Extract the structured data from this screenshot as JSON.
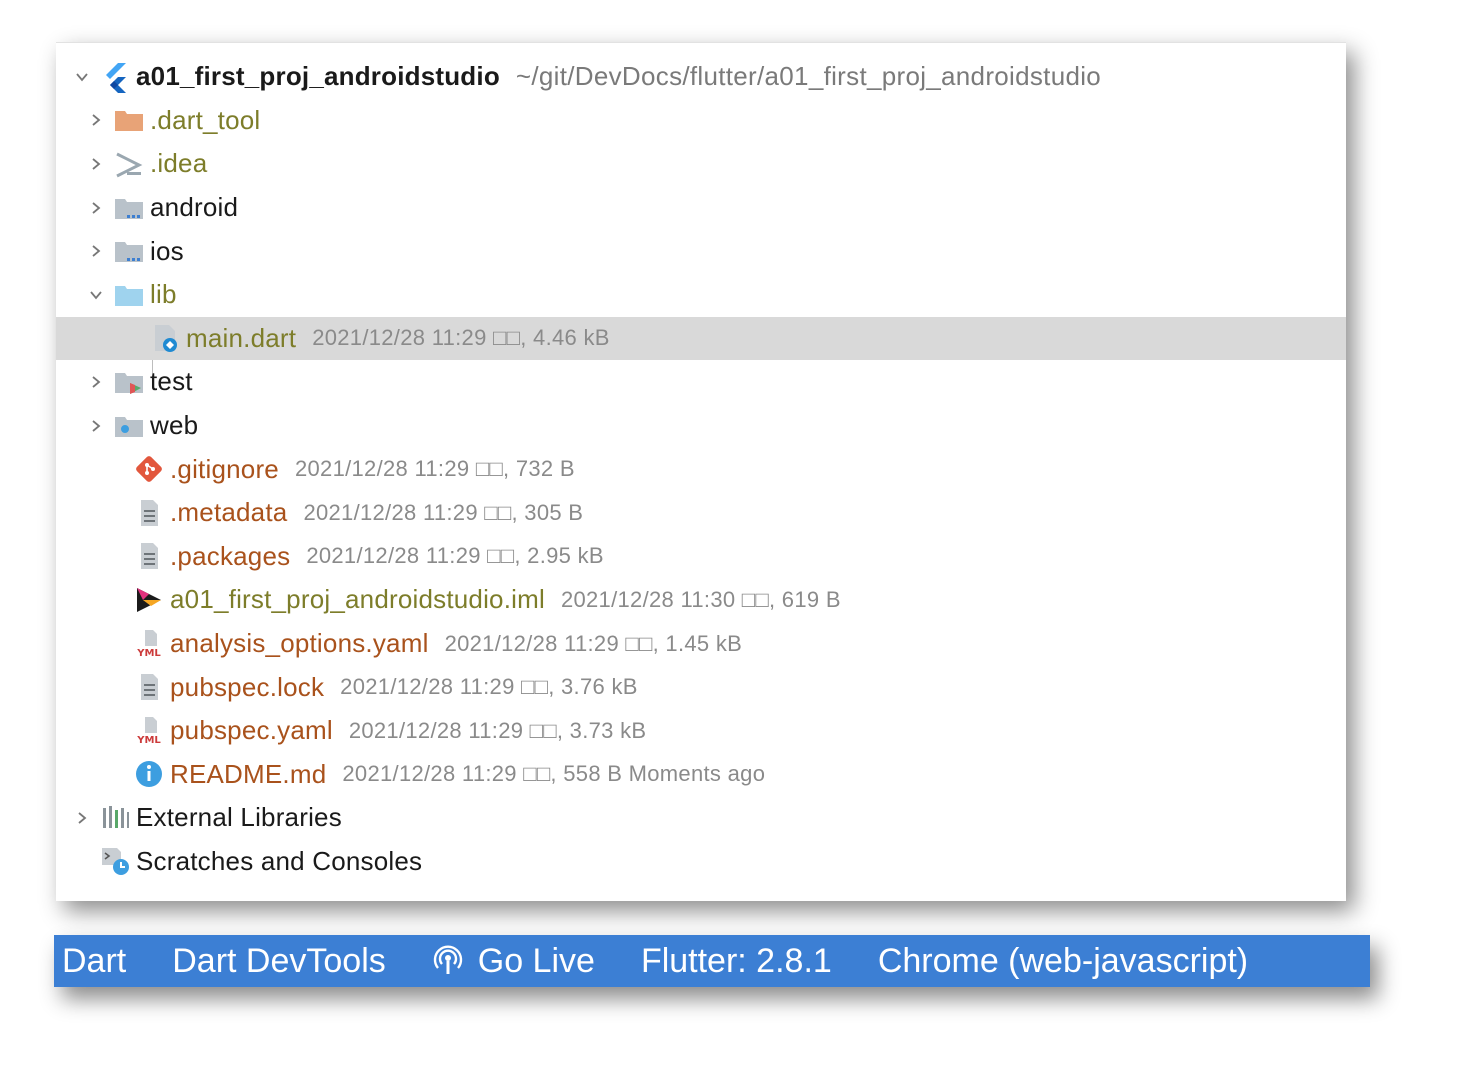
{
  "project": {
    "name": "a01_first_proj_androidstudio",
    "path": "~/git/DevDocs/flutter/a01_first_proj_androidstudio"
  },
  "tree": {
    "dart_tool": ".dart_tool",
    "idea": ".idea",
    "android": "android",
    "ios": "ios",
    "lib": "lib",
    "main_dart": {
      "name": "main.dart",
      "meta": "2021/12/28 11:29 □□, 4.46 kB"
    },
    "test": "test",
    "web": "web",
    "gitignore": {
      "name": ".gitignore",
      "meta": "2021/12/28 11:29 □□, 732 B"
    },
    "metadata": {
      "name": ".metadata",
      "meta": "2021/12/28 11:29 □□, 305 B"
    },
    "packages": {
      "name": ".packages",
      "meta": "2021/12/28 11:29 □□, 2.95 kB"
    },
    "iml": {
      "name": "a01_first_proj_androidstudio.iml",
      "meta": "2021/12/28 11:30 □□, 619 B"
    },
    "analysis": {
      "name": "analysis_options.yaml",
      "meta": "2021/12/28 11:29 □□, 1.45 kB"
    },
    "pubspec_lock": {
      "name": "pubspec.lock",
      "meta": "2021/12/28 11:29 □□, 3.76 kB"
    },
    "pubspec_yaml": {
      "name": "pubspec.yaml",
      "meta": "2021/12/28 11:29 □□, 3.73 kB"
    },
    "readme": {
      "name": "README.md",
      "meta": "2021/12/28 11:29 □□, 558 B Moments ago"
    },
    "external_libraries": "External Libraries",
    "scratches": "Scratches and Consoles"
  },
  "statusbar": {
    "dart": "Dart",
    "devtools": "Dart DevTools",
    "go_live": "Go Live",
    "flutter": "Flutter: 2.8.1",
    "device": "Chrome (web-javascript)"
  },
  "colors": {
    "statusbar_bg": "#3c7fd4",
    "selected_row": "#d9d9d9",
    "excluded_folder": "#7d7d2a",
    "unversioned_file": "#a9521c"
  }
}
